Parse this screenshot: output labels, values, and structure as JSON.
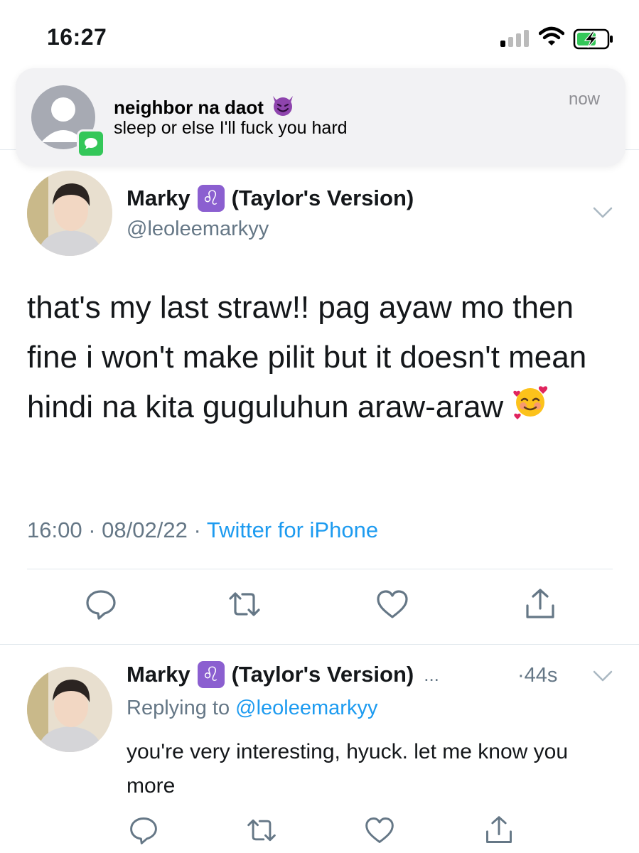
{
  "status_bar": {
    "time": "16:27"
  },
  "notification": {
    "sender": "neighbor na daot",
    "sender_emoji": "😈",
    "message": "sleep or else I'll fuck you hard",
    "time": "now",
    "app_icon": "messages-icon"
  },
  "tweet": {
    "display_name": "Marky",
    "badge": "♌",
    "name_suffix": "(Taylor's Version)",
    "handle": "@leoleemarkyy",
    "text": "that's my last straw!! pag ayaw mo then fine i won't make pilit but it doesn't mean hindi na kita guguluhun araw-araw",
    "text_emoji": "🥰",
    "time": "16:00",
    "date": "08/02/22",
    "source": "Twitter for iPhone",
    "separator": "·",
    "actions": [
      "reply-icon",
      "retweet-icon",
      "like-icon",
      "share-icon"
    ]
  },
  "reply": {
    "display_name": "Marky",
    "badge": "♌",
    "name_suffix": "(Taylor's Version)",
    "ellipsis": "...",
    "time": "·44s",
    "replying_prefix": "Replying to",
    "replying_to": "@leoleemarkyy",
    "text": "you're very interesting, hyuck. let me know you more",
    "actions": [
      "reply-icon",
      "retweet-icon",
      "like-icon",
      "share-icon"
    ]
  },
  "colors": {
    "link_blue": "#1d9bf0",
    "secondary_text": "#657786",
    "zodiac_badge": "#8b5fd0",
    "messages_green": "#34c759",
    "battery_green": "#34c759"
  }
}
